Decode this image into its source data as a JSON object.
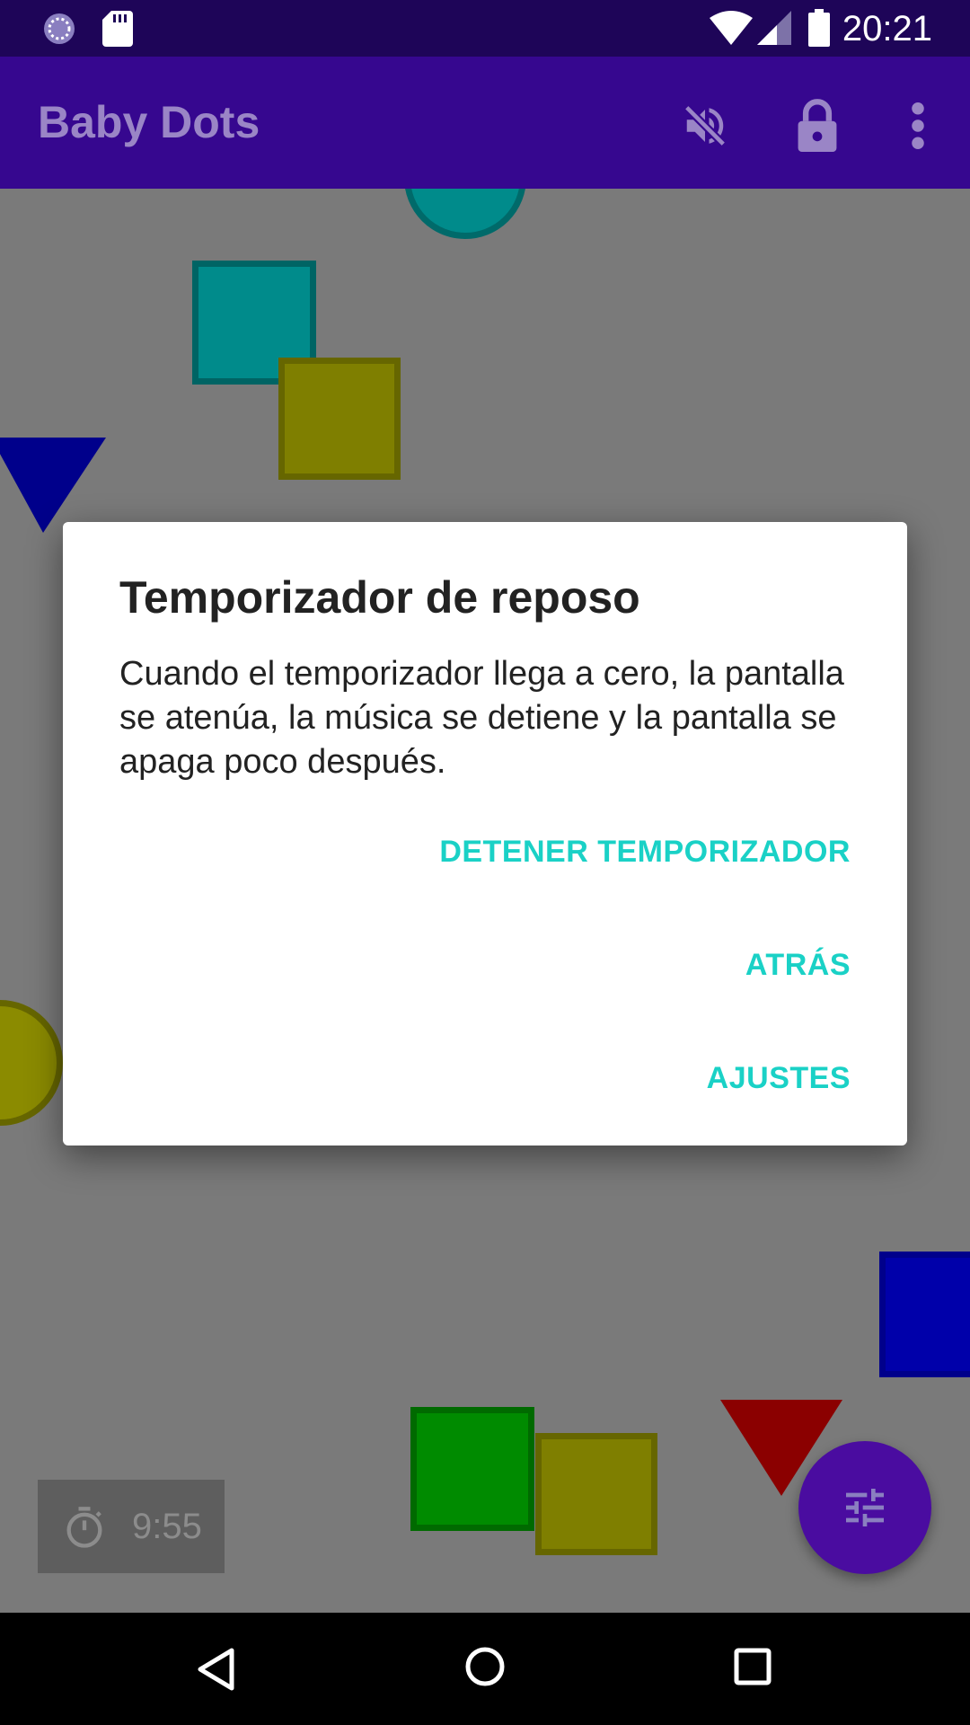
{
  "status_bar": {
    "time": "20:21"
  },
  "app_bar": {
    "title": "Baby Dots",
    "icons": [
      "volume-off-icon",
      "lock-icon",
      "more-vert-icon"
    ]
  },
  "dialog": {
    "title": "Temporizador de reposo",
    "body": "Cuando el temporizador llega a cero, la pantalla se atenúa, la música se detiene y la pantalla se apaga poco después.",
    "buttons": {
      "stop": "DETENER TEMPORIZADOR",
      "back": "ATRÁS",
      "settings": "AJUSTES"
    }
  },
  "timer": {
    "value": "9:55"
  },
  "colors": {
    "app_bar": "#36078f",
    "status_bar": "#1e0558",
    "accent": "#1ad1c6",
    "fab": "#4a0ca0"
  }
}
